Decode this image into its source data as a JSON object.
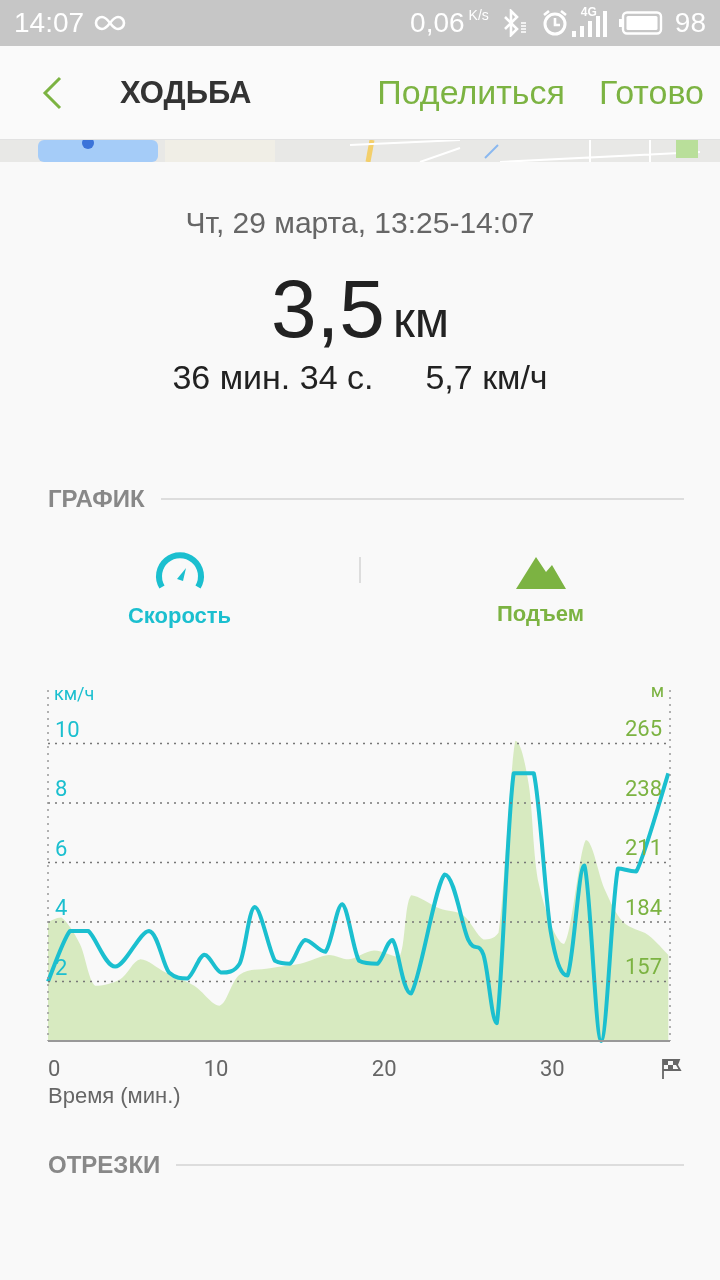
{
  "status_bar": {
    "time": "14:07",
    "speed": "0,06",
    "speed_unit": "K/s",
    "network": "4G",
    "battery": "98"
  },
  "header": {
    "title": "ХОДЬБА",
    "actions": [
      "Поделиться",
      "Готово"
    ]
  },
  "summary": {
    "date": "Чт, 29 марта, 13:25-14:07",
    "distance": "3,5",
    "distance_unit": "км",
    "duration": "36 мин. 34 с.",
    "avg_speed": "5,7 км/ч"
  },
  "graph_section": {
    "title": "ГРАФИК",
    "toggles": [
      {
        "kind": "speed",
        "label": "Скорость",
        "on": true,
        "color": "#1bbfcf"
      },
      {
        "kind": "elevation",
        "label": "Подъем",
        "on": true,
        "color": "#7cb342"
      }
    ],
    "chart_data": {
      "type": "line",
      "grid": true,
      "ylabel": "км/ч",
      "y2label": "м",
      "xlabel": "Время (мин.)",
      "xlim": [
        0,
        37
      ],
      "ylim": [
        0,
        11.8
      ],
      "y2lim": [
        130,
        289
      ],
      "xticks": [
        0,
        10,
        20,
        30
      ],
      "yticks": [
        2,
        4,
        6,
        8,
        10
      ],
      "y2ticks": [
        157,
        184,
        211,
        238,
        265
      ],
      "series": [
        {
          "color": "#1bbfcf",
          "x": [
            0,
            1.3,
            2.4,
            4,
            6,
            7.2,
            8.3,
            9.3,
            10.3,
            11.4,
            12.3,
            13.5,
            14.4,
            15.3,
            16.5,
            17.5,
            18.5,
            19.6,
            20.5,
            21.6,
            23.6,
            25,
            25.9,
            26.7,
            27.7,
            28.9,
            29.9,
            30.9,
            31.9,
            32.9,
            33.9,
            35,
            36.9
          ],
          "values": [
            2,
            3.7,
            3.7,
            2.5,
            3.7,
            2.3,
            2.1,
            2.9,
            2.3,
            2.6,
            4.5,
            2.7,
            2.6,
            3.4,
            3,
            4.6,
            2.7,
            2.6,
            3.4,
            1.6,
            5.6,
            3.4,
            2.9,
            0.6,
            9,
            9,
            3.7,
            2.2,
            5.9,
            0,
            5.8,
            5.7,
            9
          ]
        },
        {
          "type": "area",
          "axis": "y2",
          "color": "#d7eac0",
          "x": [
            0,
            0.8,
            1.9,
            2.8,
            4.3,
            5.5,
            7,
            8.7,
            10.2,
            11.4,
            13.2,
            15,
            16.7,
            17.9,
            19.4,
            20.9,
            21.6,
            23.3,
            24.7,
            25.9,
            26.8,
            27.8,
            28.6,
            29.2,
            30.7,
            32,
            33.1,
            34.2,
            35.7,
            36.9
          ],
          "values": [
            184,
            186,
            174,
            155,
            158,
            167,
            161,
            155,
            146,
            160,
            163,
            165,
            169,
            167,
            171,
            168,
            196,
            190,
            187,
            176,
            179,
            266,
            246,
            201,
            174,
            221,
            199,
            184,
            178,
            169
          ]
        }
      ]
    }
  },
  "segments_section": {
    "title": "ОТРЕЗКИ"
  }
}
